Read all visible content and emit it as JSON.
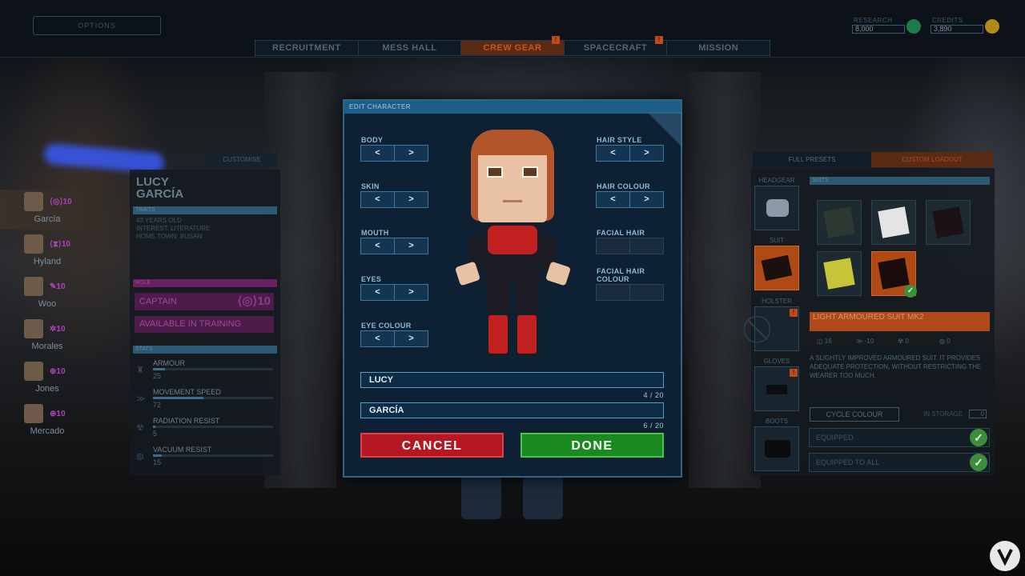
{
  "topbar": {
    "options_label": "OPTIONS",
    "tabs": [
      "RECRUITMENT",
      "MESS HALL",
      "CREW GEAR",
      "SPACECRAFT",
      "MISSION"
    ],
    "active_tab": "CREW GEAR",
    "research_label": "RESEARCH",
    "research_value": "8,000",
    "credits_label": "CREDITS",
    "credits_value": "3,890"
  },
  "crew": {
    "customise_label": "CUSTOMISE",
    "list": [
      {
        "name": "García",
        "rank": "10"
      },
      {
        "name": "Hyland",
        "rank": "10"
      },
      {
        "name": "Woo",
        "rank": "10"
      },
      {
        "name": "Morales",
        "rank": "10"
      },
      {
        "name": "Jones",
        "rank": "10"
      },
      {
        "name": "Mercado",
        "rank": "10"
      }
    ]
  },
  "profile": {
    "first_name": "LUCY",
    "last_name": "GARCÍA",
    "traits_header": "TRAITS",
    "age": "43 YEARS OLD",
    "interest": "INTEREST: LITERATURE",
    "hometown": "HOME TOWN: BUSAN",
    "role_header": "ROLE",
    "role": "CAPTAIN",
    "role_rank": "10",
    "availability": "AVAILABLE IN TRAINING",
    "stats_header": "STATS",
    "stats": [
      {
        "label": "ARMOUR",
        "value": "25",
        "fraction": 0.1
      },
      {
        "label": "MOVEMENT SPEED",
        "value": "72",
        "fraction": 0.42
      },
      {
        "label": "RADIATION RESIST",
        "value": "5",
        "fraction": 0.02
      },
      {
        "label": "VACUUM RESIST",
        "value": "15",
        "fraction": 0.07
      }
    ]
  },
  "editor": {
    "title": "EDIT CHARACTER",
    "left_options": [
      "BODY",
      "SKIN",
      "MOUTH",
      "EYES",
      "EYE COLOUR"
    ],
    "right_options": [
      "HAIR STYLE",
      "HAIR COLOUR",
      "FACIAL HAIR",
      "FACIAL HAIR COLOUR"
    ],
    "prev": "<",
    "next": ">",
    "first_name_value": "LUCY",
    "first_name_count": "4 / 20",
    "last_name_value": "GARCÍA",
    "last_name_count": "6 / 20",
    "cancel_label": "CANCEL",
    "done_label": "DONE",
    "colors": {
      "cancel": "#b51820",
      "done": "#1a8a20",
      "accent": "#1e5d86"
    }
  },
  "gear": {
    "full_presets_label": "FULL PRESETS",
    "custom_loadout_label": "CUSTOM LOADOUT",
    "slots": [
      "HEADGEAR",
      "SUIT",
      "HOLSTER",
      "GLOVES",
      "BOOTS"
    ],
    "suits_header": "SUITS",
    "selected_item": "LIGHT ARMOURED SUIT MK2",
    "description": "A SLIGHTLY IMPROVED ARMOURED SUIT. IT PROVIDES ADEQUATE PROTECTION, WITHOUT RESTRICTING THE WEARER TOO MUCH.",
    "stat_values": [
      "16",
      "-10",
      "0",
      "0"
    ],
    "cycle_colour_label": "CYCLE COLOUR",
    "in_storage_label": "IN STORAGE",
    "in_storage_value": "0",
    "equipped_label": "EQUIPPED",
    "equipped_to_all_label": "EQUIPPED TO ALL"
  }
}
